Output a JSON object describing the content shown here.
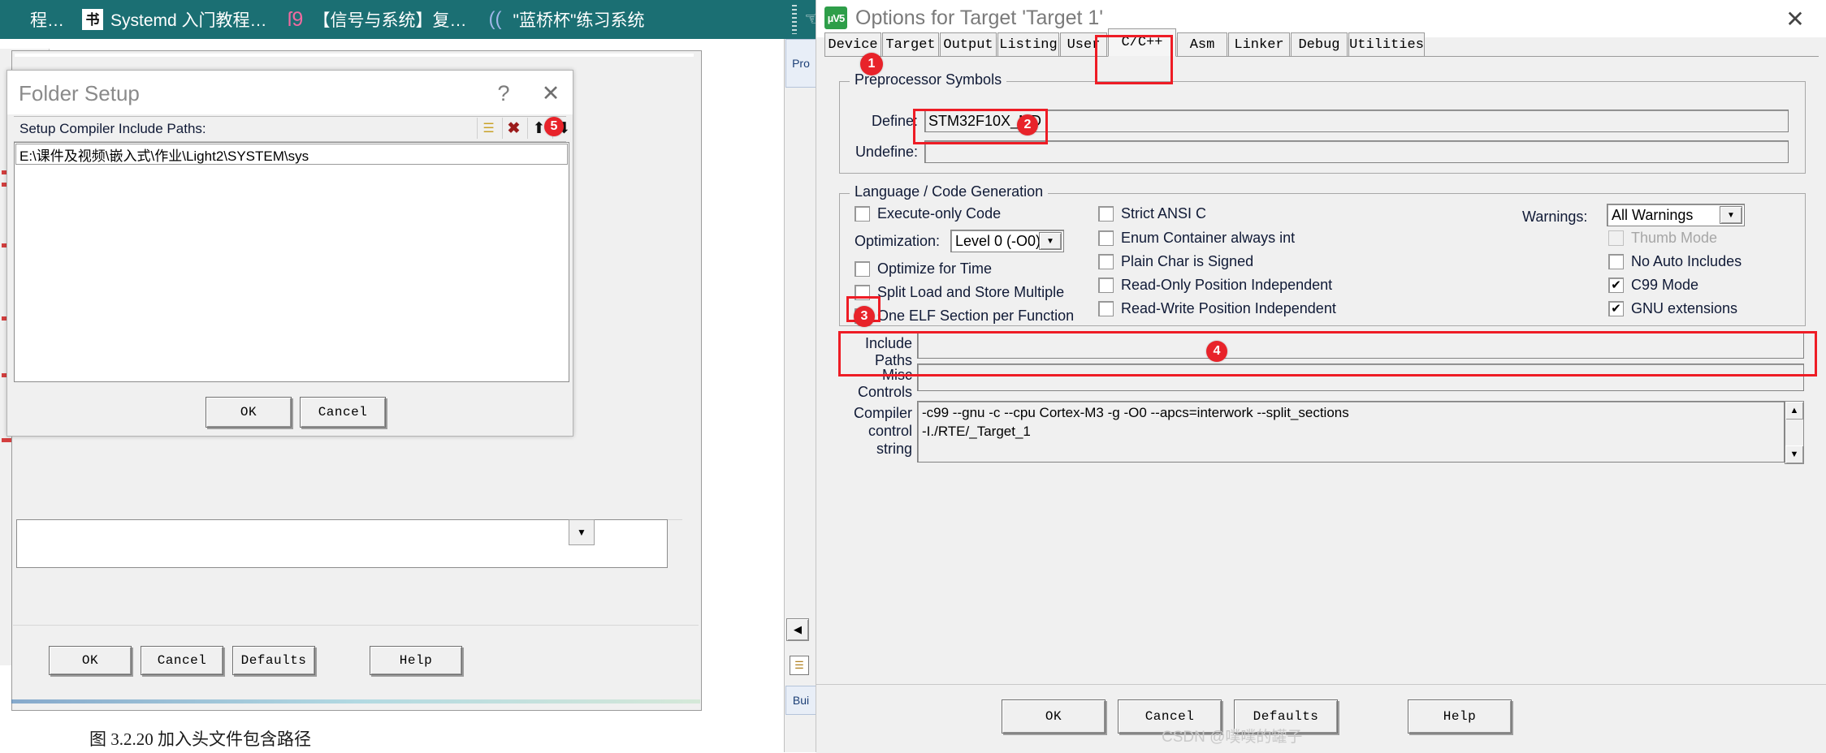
{
  "browser": {
    "bookmarks": [
      {
        "icon": "text-icon",
        "glyph": "",
        "label": "程…"
      },
      {
        "icon": "book-icon",
        "glyph": "书",
        "label": "Systemd 入门教程…"
      },
      {
        "icon": "signal-icon",
        "glyph": "ſ9",
        "label": "【信号与系统】复…"
      },
      {
        "icon": "cup-icon",
        "glyph": "((",
        "label": "\"蓝桥杯\"练习系统"
      }
    ],
    "overflow_icon": "pin-icon"
  },
  "ide": {
    "project_tab": "Pro",
    "build_tab": "Bui",
    "collapse_icon": "left-arrow-icon",
    "panel_icon": "list-icon",
    "buttons": [
      {
        "label": "OK"
      },
      {
        "label": "Cancel"
      },
      {
        "label": "Defaults"
      },
      {
        "label": "Help"
      }
    ]
  },
  "folder_dialog": {
    "title": "Folder Setup",
    "help_icon": "question-mark-icon",
    "close_icon": "close-icon",
    "toolbar_label": "Setup Compiler Include Paths:",
    "tools": [
      {
        "name": "new-path-icon",
        "glyph": "▩"
      },
      {
        "name": "delete-path-icon",
        "glyph": "✕"
      },
      {
        "name": "move-up-icon",
        "glyph": "↑"
      },
      {
        "name": "move-down-icon",
        "glyph": "↓"
      }
    ],
    "paths": [
      "E:\\课件及视频\\嵌入式\\作业\\Light2\\SYSTEM\\sys"
    ],
    "ok_label": "OK",
    "cancel_label": "Cancel"
  },
  "options": {
    "app_icon": "keil-uvision-icon",
    "title": "Options for Target 'Target 1'",
    "close_icon": "close-icon",
    "tabs": [
      {
        "label": "Device",
        "active": false
      },
      {
        "label": "Target",
        "active": false
      },
      {
        "label": "Output",
        "active": false
      },
      {
        "label": "Listing",
        "active": false
      },
      {
        "label": "User",
        "active": false
      },
      {
        "label": "C/C++",
        "active": true
      },
      {
        "label": "Asm",
        "active": false
      },
      {
        "label": "Linker",
        "active": false
      },
      {
        "label": "Debug",
        "active": false
      },
      {
        "label": "Utilities",
        "active": false
      }
    ],
    "preprocessor": {
      "group_title": "Preprocessor Symbols",
      "define_label": "Define:",
      "define_value": "STM32F10X_MD",
      "undefine_label": "Undefine:",
      "undefine_value": ""
    },
    "language": {
      "group_title": "Language / Code Generation",
      "left_checks": [
        {
          "label": "Execute-only Code",
          "checked": false,
          "disabled": false
        },
        {
          "label": "Optimize for Time",
          "checked": false,
          "disabled": false
        },
        {
          "label": "Split Load and Store Multiple",
          "checked": false,
          "disabled": false
        },
        {
          "label": "One ELF Section per Function",
          "checked": true,
          "disabled": false
        }
      ],
      "optimization_label": "Optimization:",
      "optimization_value": "Level 0 (-O0)",
      "mid_checks": [
        {
          "label": "Strict ANSI C",
          "checked": false,
          "disabled": false
        },
        {
          "label": "Enum Container always int",
          "checked": false,
          "disabled": false
        },
        {
          "label": "Plain Char is Signed",
          "checked": false,
          "disabled": false
        },
        {
          "label": "Read-Only Position Independent",
          "checked": false,
          "disabled": false
        },
        {
          "label": "Read-Write Position Independent",
          "checked": false,
          "disabled": false
        }
      ],
      "warnings_label": "Warnings:",
      "warnings_value": "All Warnings",
      "right_checks": [
        {
          "label": "Thumb Mode",
          "checked": false,
          "disabled": true
        },
        {
          "label": "No Auto Includes",
          "checked": false,
          "disabled": false
        },
        {
          "label": "C99 Mode",
          "checked": true,
          "disabled": false
        },
        {
          "label": "GNU extensions",
          "checked": true,
          "disabled": false
        }
      ]
    },
    "paths_section": {
      "include_label_line1": "Include",
      "include_label_line2": "Paths",
      "include_value": "",
      "misc_label_line1": "Misc",
      "misc_label_line2": "Controls",
      "misc_value": "",
      "compiler_label_line1": "Compiler",
      "compiler_label_line2": "control",
      "compiler_label_line3": "string",
      "compiler_value": "-c99 --gnu -c --cpu Cortex-M3 -g -O0 --apcs=interwork --split_sections\n-I./RTE/_Target_1",
      "scroll_up_icon": "caret-up-icon",
      "scroll_down_icon": "caret-down-icon"
    },
    "footer": [
      {
        "label": "OK"
      },
      {
        "label": "Cancel"
      },
      {
        "label": "Defaults"
      },
      {
        "label": "Help"
      }
    ]
  },
  "annotations": [
    {
      "number": "1",
      "target": "cpp-tab"
    },
    {
      "number": "2",
      "target": "define-field"
    },
    {
      "number": "3",
      "target": "one-elf-section-checkbox"
    },
    {
      "number": "4",
      "target": "include-paths-field"
    },
    {
      "number": "5",
      "target": "include-path-list-row"
    }
  ],
  "caption": "图 3.2.20 加入头文件包含路径",
  "watermark": "CSDN @噗噗的罐子"
}
